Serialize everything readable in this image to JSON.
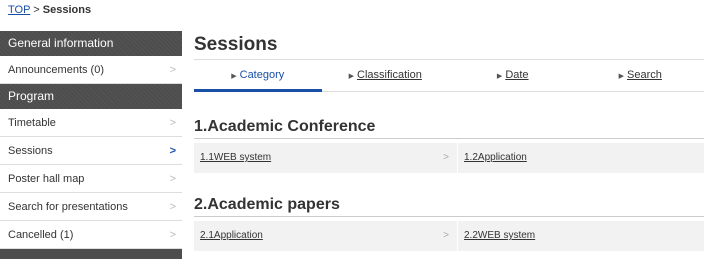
{
  "breadcrumb": {
    "top": "TOP",
    "sep": ">",
    "current": "Sessions"
  },
  "sidebar": {
    "general_header": "General information",
    "announcements": "Announcements (0)",
    "program_header": "Program",
    "items": [
      "Timetable",
      "Sessions",
      "Poster hall map",
      "Search for presentations",
      "Cancelled (1)"
    ],
    "chevron": ">"
  },
  "main": {
    "title": "Sessions",
    "tabs": [
      {
        "arrow": "▶",
        "label": "Category"
      },
      {
        "arrow": "▶",
        "label": "Classification"
      },
      {
        "arrow": "▶",
        "label": "Date"
      },
      {
        "arrow": "▶",
        "label": "Search"
      }
    ],
    "sections": [
      {
        "title": "1.Academic Conference",
        "links": [
          "1.1WEB system",
          "1.2Application"
        ]
      },
      {
        "title": "2.Academic papers",
        "links": [
          "2.1Application",
          "2.2WEB system"
        ]
      }
    ],
    "chevron": ">"
  },
  "colors": {
    "accent": "#1a4fa8",
    "sidebar_header": "#4d4d4d",
    "row_bg": "#f2f2f2"
  }
}
